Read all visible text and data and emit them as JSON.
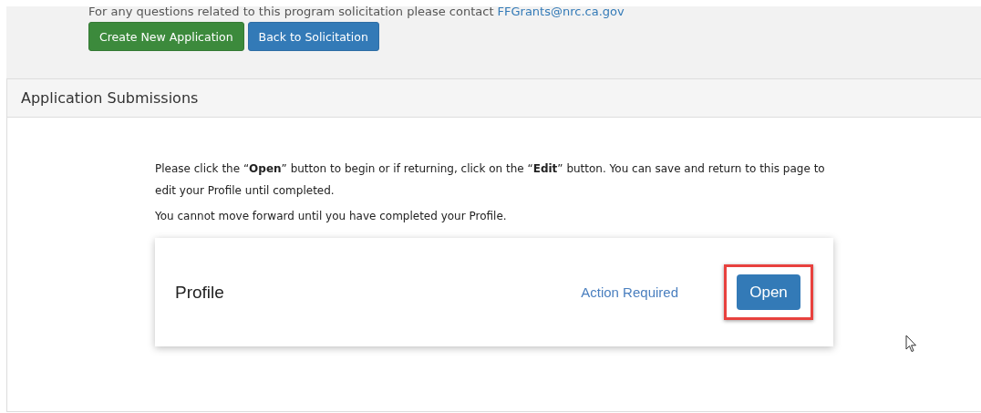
{
  "contact": {
    "text": "For any questions related to this program solicitation please contact",
    "email": "FFGrants@nrc.ca.gov"
  },
  "buttons": [
    {
      "label": "Create New Application",
      "kind": "success"
    },
    {
      "label": "Back to Solicitation",
      "kind": "primary"
    }
  ],
  "panel": {
    "title": "Application Submissions",
    "instructions": [
      "Please click the “**Open**” button to begin or if returning, click on the “**Edit**” button.  You can save and return to this page to edit your Profile until completed.",
      "You cannot move forward until you have completed your Profile."
    ],
    "items": [
      {
        "name": "Profile",
        "status": "Action Required",
        "action": "Open",
        "highlighted": true
      }
    ]
  }
}
